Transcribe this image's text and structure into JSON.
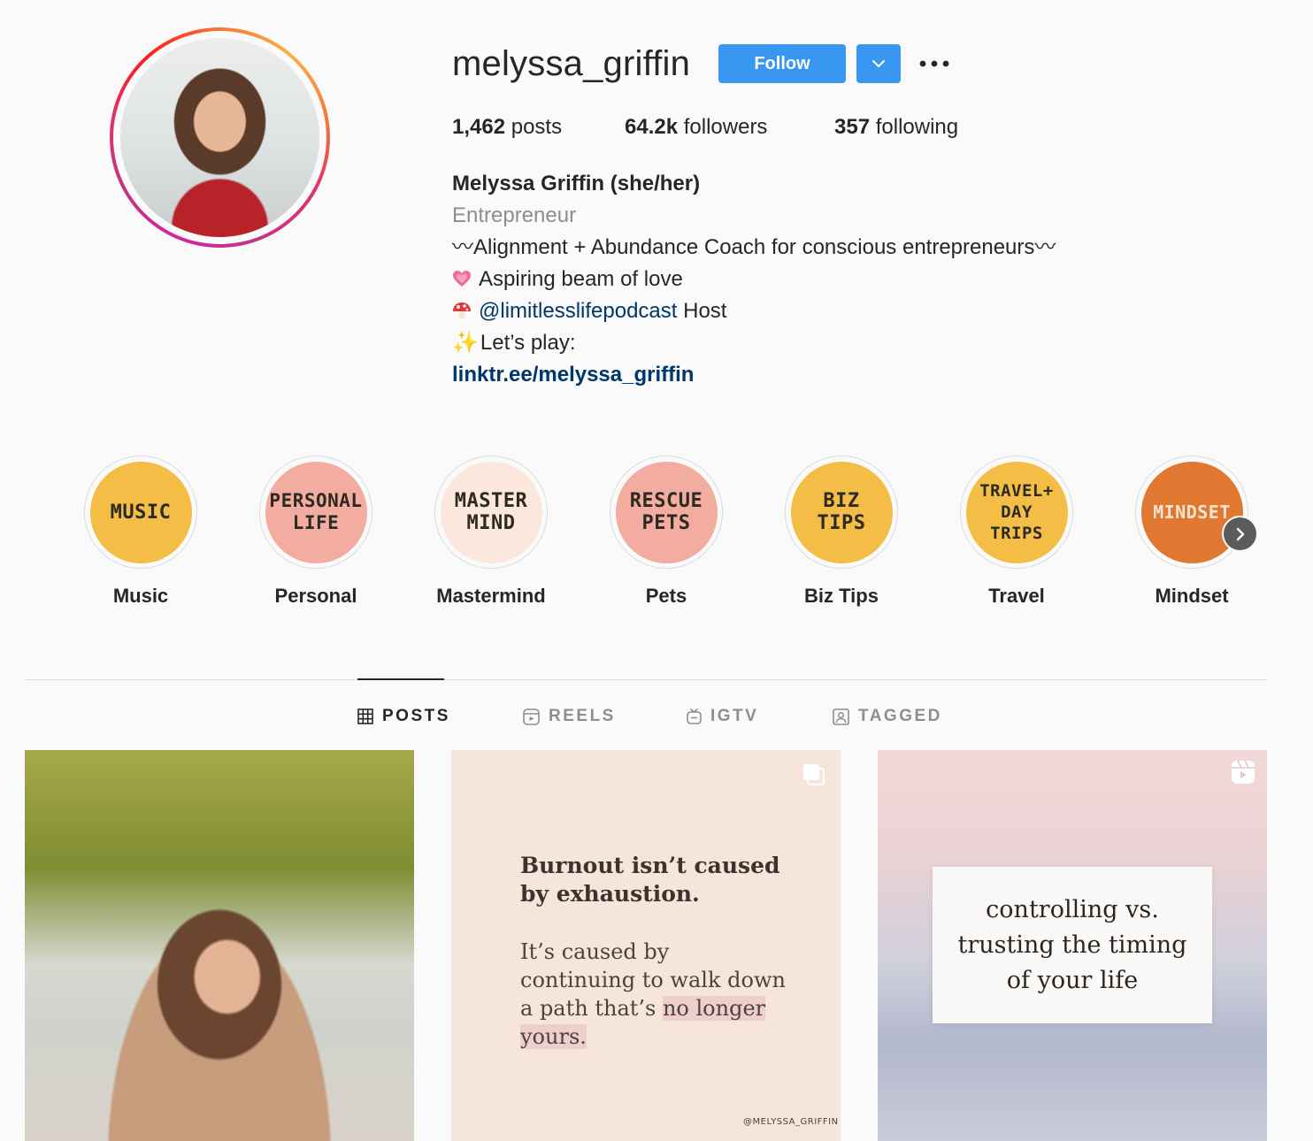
{
  "profile": {
    "username": "melyssa_griffin",
    "follow_label": "Follow",
    "stats": {
      "posts_count": "1,462",
      "posts_label": " posts",
      "followers_count": "64.2k",
      "followers_label": " followers",
      "following_count": "357",
      "following_label": " following"
    },
    "bio": {
      "full_name": "Melyssa Griffin (she/her)",
      "category": "Entrepreneur",
      "line1": "〰Alignment + Abundance Coach for conscious entrepreneurs〰",
      "line2": "Aspiring beam of love",
      "line3_mention": "@limitlesslifepodcast",
      "line3_suffix": " Host",
      "line4_spark": "✨",
      "line4": "Let’s play:",
      "link": "linktr.ee/melyssa_griffin"
    }
  },
  "highlights": [
    {
      "cover": "MUSIC",
      "label": "Music",
      "color": "#f4bd45"
    },
    {
      "cover": "PERSONAL LIFE",
      "label": "Personal",
      "color": "#f2aca0"
    },
    {
      "cover": "MASTER MIND",
      "label": "Mastermind",
      "color": "#fbe7dc"
    },
    {
      "cover": "RESCUE PETS",
      "label": "Pets",
      "color": "#f2aca0"
    },
    {
      "cover": "BIZ TIPS",
      "label": "Biz Tips",
      "color": "#f4bd45"
    },
    {
      "cover": "TRAVEL+ DAY TRIPS",
      "label": "Travel",
      "color": "#f4bd45"
    },
    {
      "cover": "MINDSET",
      "label": "Mindset",
      "color": "#e07832"
    }
  ],
  "tabs": {
    "posts": "POSTS",
    "reels": "REELS",
    "igtv": "IGTV",
    "tagged": "TAGGED"
  },
  "posts": {
    "post2": {
      "heading_line1": "Burnout isn’t caused",
      "heading_line2": "by exhaustion.",
      "body_part1": "It’s caused by continuing to walk down a path that’s ",
      "body_highlight": "no longer yours.",
      "signature": "@MELYSSA_GRIFFIN"
    },
    "post3": {
      "line1": "controlling vs.",
      "line2": "trusting the timing",
      "line3": "of your life"
    }
  },
  "icons": {
    "dropdown": "chevron-down-icon",
    "more": "more-options-icon",
    "highlight_next": "chevron-right-icon",
    "posts_tab": "grid-icon",
    "reels_tab": "reels-icon",
    "igtv_tab": "igtv-icon",
    "tagged_tab": "tagged-icon",
    "carousel": "carousel-icon",
    "reel": "reel-icon"
  },
  "colors": {
    "follow_button": "#3897f0",
    "link": "#00376b",
    "muted_text": "#8e8e8e"
  }
}
